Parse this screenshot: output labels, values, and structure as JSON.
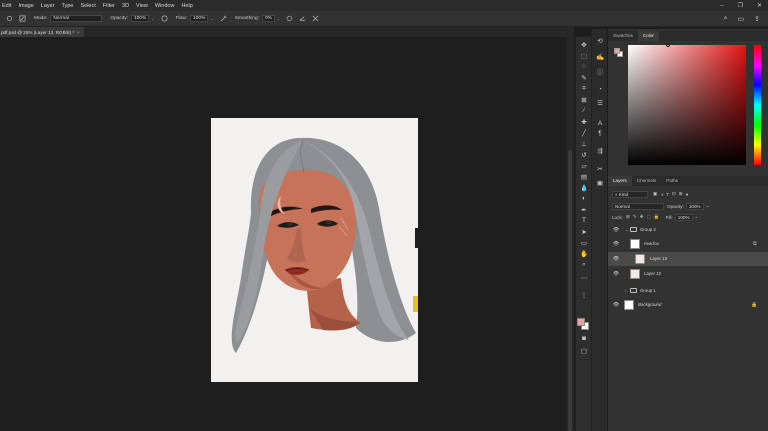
{
  "menu": [
    "Edit",
    "Image",
    "Layer",
    "Type",
    "Select",
    "Filter",
    "3D",
    "View",
    "Window",
    "Help"
  ],
  "window_controls": [
    "–",
    "❐",
    "✕"
  ],
  "options": {
    "mode_label": "Mode:",
    "mode_value": "Normal",
    "opacity_label": "Opacity:",
    "opacity_value": "100%",
    "flow_label": "Flow:",
    "flow_value": "100%",
    "smoothing_label": "Smoothing:",
    "smoothing_value": "0%"
  },
  "document_tab": {
    "title": "pdf.psd @ 25% (Layer 13, RGB/8) *",
    "close": "×"
  },
  "panels": {
    "color_tabs": [
      "Swatches",
      "Color"
    ],
    "color_active": "Color",
    "foreground": "#e7a49a",
    "background": "#ffffff",
    "layer_tabs": [
      "Layers",
      "Channels",
      "Paths"
    ],
    "layers_active": "Layers"
  },
  "layers_panel": {
    "kind_label": "Kind",
    "blend_mode": "Normal",
    "opacity_label": "Opacity:",
    "opacity_value": "100%",
    "lock_label": "Lock:",
    "fill_label": "Fill:",
    "fill_value": "100%",
    "layers": [
      {
        "name": "Group 2",
        "type": "group",
        "expanded": true,
        "visible": true
      },
      {
        "name": "new.fox",
        "type": "smart-object",
        "visible": true
      },
      {
        "name": "Layer 13",
        "type": "layer",
        "visible": true,
        "selected": true
      },
      {
        "name": "Layer 12",
        "type": "layer",
        "visible": true
      },
      {
        "name": "Group 1",
        "type": "group",
        "expanded": false,
        "visible": false
      },
      {
        "name": "Background",
        "type": "background",
        "visible": true,
        "locked": true
      }
    ]
  }
}
